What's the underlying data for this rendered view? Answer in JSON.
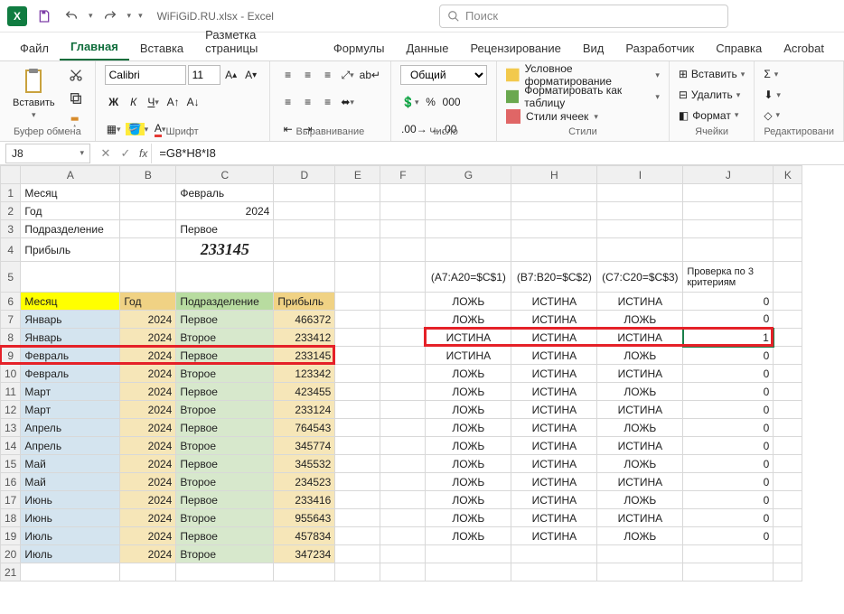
{
  "title": "WiFiGiD.RU.xlsx - Excel",
  "search_placeholder": "Поиск",
  "menu": [
    "Файл",
    "Главная",
    "Вставка",
    "Разметка страницы",
    "Формулы",
    "Данные",
    "Рецензирование",
    "Вид",
    "Разработчик",
    "Справка",
    "Acrobat"
  ],
  "active_menu": 1,
  "ribbon": {
    "paste": "Вставить",
    "clipboard": "Буфер обмена",
    "font_name": "Calibri",
    "font_size": "11",
    "font_group": "Шрифт",
    "align_group": "Выравнивание",
    "number_format": "Общий",
    "number_group": "Число",
    "cond_fmt": "Условное форматирование",
    "fmt_table": "Форматировать как таблицу",
    "cell_styles": "Стили ячеек",
    "styles_group": "Стили",
    "insert": "Вставить",
    "delete": "Удалить",
    "format": "Формат",
    "cells_group": "Ячейки",
    "edit_group": "Редактировани"
  },
  "namebox": "J8",
  "formula": "=G8*H8*I8",
  "labels": {
    "month": "Месяц",
    "year": "Год",
    "division": "Подразделение",
    "profit": "Прибыль",
    "c1": "Февраль",
    "c2": "2024",
    "c3": "Первое",
    "c4": "233145",
    "g5": "(A7:A20=$C$1)",
    "h5": "(B7:B20=$C$2)",
    "i5": "(C7:C20=$C$3)",
    "j5": "Проверка по 3 критериям"
  },
  "hdr": {
    "a": "Месяц",
    "b": "Год",
    "c": "Подразделение",
    "d": "Прибыль"
  },
  "rows": [
    {
      "a": "Январь",
      "b": "2024",
      "c": "Первое",
      "d": "466372",
      "g": "ЛОЖЬ",
      "h": "ИСТИНА",
      "i": "ИСТИНА",
      "j": "0"
    },
    {
      "a": "Январь",
      "b": "2024",
      "c": "Второе",
      "d": "233412",
      "g": "ЛОЖЬ",
      "h": "ИСТИНА",
      "i": "ЛОЖЬ",
      "j": "0"
    },
    {
      "a": "Февраль",
      "b": "2024",
      "c": "Первое",
      "d": "233145",
      "g": "ИСТИНА",
      "h": "ИСТИНА",
      "i": "ИСТИНА",
      "j": "1"
    },
    {
      "a": "Февраль",
      "b": "2024",
      "c": "Второе",
      "d": "123342",
      "g": "ИСТИНА",
      "h": "ИСТИНА",
      "i": "ЛОЖЬ",
      "j": "0"
    },
    {
      "a": "Март",
      "b": "2024",
      "c": "Первое",
      "d": "423455",
      "g": "ЛОЖЬ",
      "h": "ИСТИНА",
      "i": "ИСТИНА",
      "j": "0"
    },
    {
      "a": "Март",
      "b": "2024",
      "c": "Второе",
      "d": "233124",
      "g": "ЛОЖЬ",
      "h": "ИСТИНА",
      "i": "ЛОЖЬ",
      "j": "0"
    },
    {
      "a": "Апрель",
      "b": "2024",
      "c": "Первое",
      "d": "764543",
      "g": "ЛОЖЬ",
      "h": "ИСТИНА",
      "i": "ИСТИНА",
      "j": "0"
    },
    {
      "a": "Апрель",
      "b": "2024",
      "c": "Второе",
      "d": "345774",
      "g": "ЛОЖЬ",
      "h": "ИСТИНА",
      "i": "ЛОЖЬ",
      "j": "0"
    },
    {
      "a": "Май",
      "b": "2024",
      "c": "Первое",
      "d": "345532",
      "g": "ЛОЖЬ",
      "h": "ИСТИНА",
      "i": "ИСТИНА",
      "j": "0"
    },
    {
      "a": "Май",
      "b": "2024",
      "c": "Второе",
      "d": "234523",
      "g": "ЛОЖЬ",
      "h": "ИСТИНА",
      "i": "ЛОЖЬ",
      "j": "0"
    },
    {
      "a": "Июнь",
      "b": "2024",
      "c": "Первое",
      "d": "233416",
      "g": "ЛОЖЬ",
      "h": "ИСТИНА",
      "i": "ИСТИНА",
      "j": "0"
    },
    {
      "a": "Июнь",
      "b": "2024",
      "c": "Второе",
      "d": "955643",
      "g": "ЛОЖЬ",
      "h": "ИСТИНА",
      "i": "ЛОЖЬ",
      "j": "0"
    },
    {
      "a": "Июль",
      "b": "2024",
      "c": "Первое",
      "d": "457834",
      "g": "ЛОЖЬ",
      "h": "ИСТИНА",
      "i": "ИСТИНА",
      "j": "0"
    },
    {
      "a": "Июль",
      "b": "2024",
      "c": "Второе",
      "d": "347234",
      "g": "ЛОЖЬ",
      "h": "ИСТИНА",
      "i": "ЛОЖЬ",
      "j": "0"
    }
  ]
}
